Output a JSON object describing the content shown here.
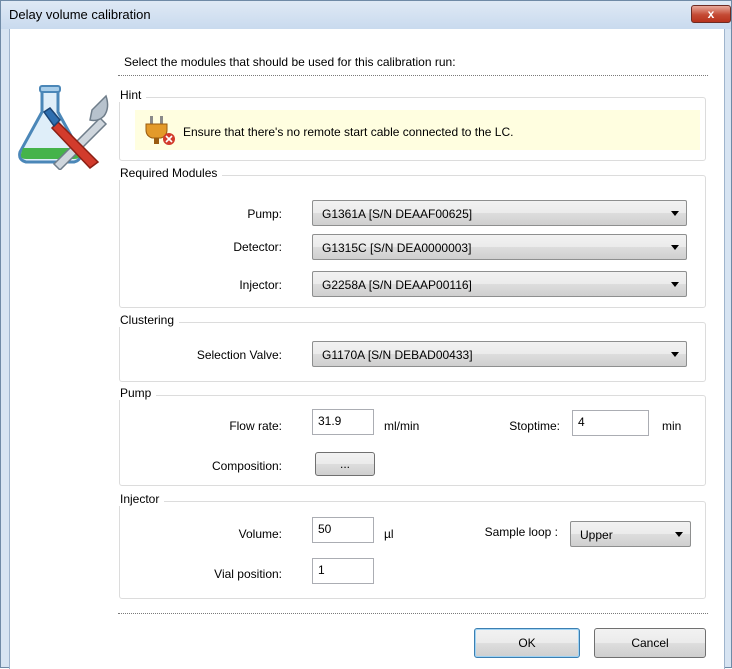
{
  "window": {
    "title": "Delay volume calibration",
    "close_glyph": "x"
  },
  "instruction": "Select the modules that should be used for this calibration run:",
  "icons": {
    "side": "lab-flask-tools-icon",
    "hint": "plug-warning-icon"
  },
  "hint": {
    "title": "Hint",
    "text": "Ensure that there's no remote start cable connected to the LC.",
    "background": "#fffee0"
  },
  "required_modules": {
    "title": "Required Modules",
    "pump_label": "Pump:",
    "pump_value": "G1361A [S/N DEAAF00625]",
    "detector_label": "Detector:",
    "detector_value": "G1315C [S/N DEA0000003]",
    "injector_label": "Injector:",
    "injector_value": "G2258A [S/N DEAAP00116]"
  },
  "clustering": {
    "title": "Clustering",
    "valve_label": "Selection Valve:",
    "valve_value": "G1170A [S/N DEBAD00433]"
  },
  "pump": {
    "title": "Pump",
    "flow_label": "Flow rate:",
    "flow_value": "31.9",
    "flow_unit": "ml/min",
    "stop_label": "Stoptime:",
    "stop_value": "4",
    "stop_unit": "min",
    "composition_label": "Composition:",
    "composition_button": "..."
  },
  "injector": {
    "title": "Injector",
    "volume_label": "Volume:",
    "volume_value": "50",
    "volume_unit": "µl",
    "loop_label": "Sample loop :",
    "loop_value": "Upper",
    "vial_label": "Vial position:",
    "vial_value": "1"
  },
  "buttons": {
    "ok": "OK",
    "cancel": "Cancel"
  },
  "colors": {
    "title_bar": "#c9daee",
    "close": "#c44a34",
    "default_border": "#3c7fb1"
  }
}
